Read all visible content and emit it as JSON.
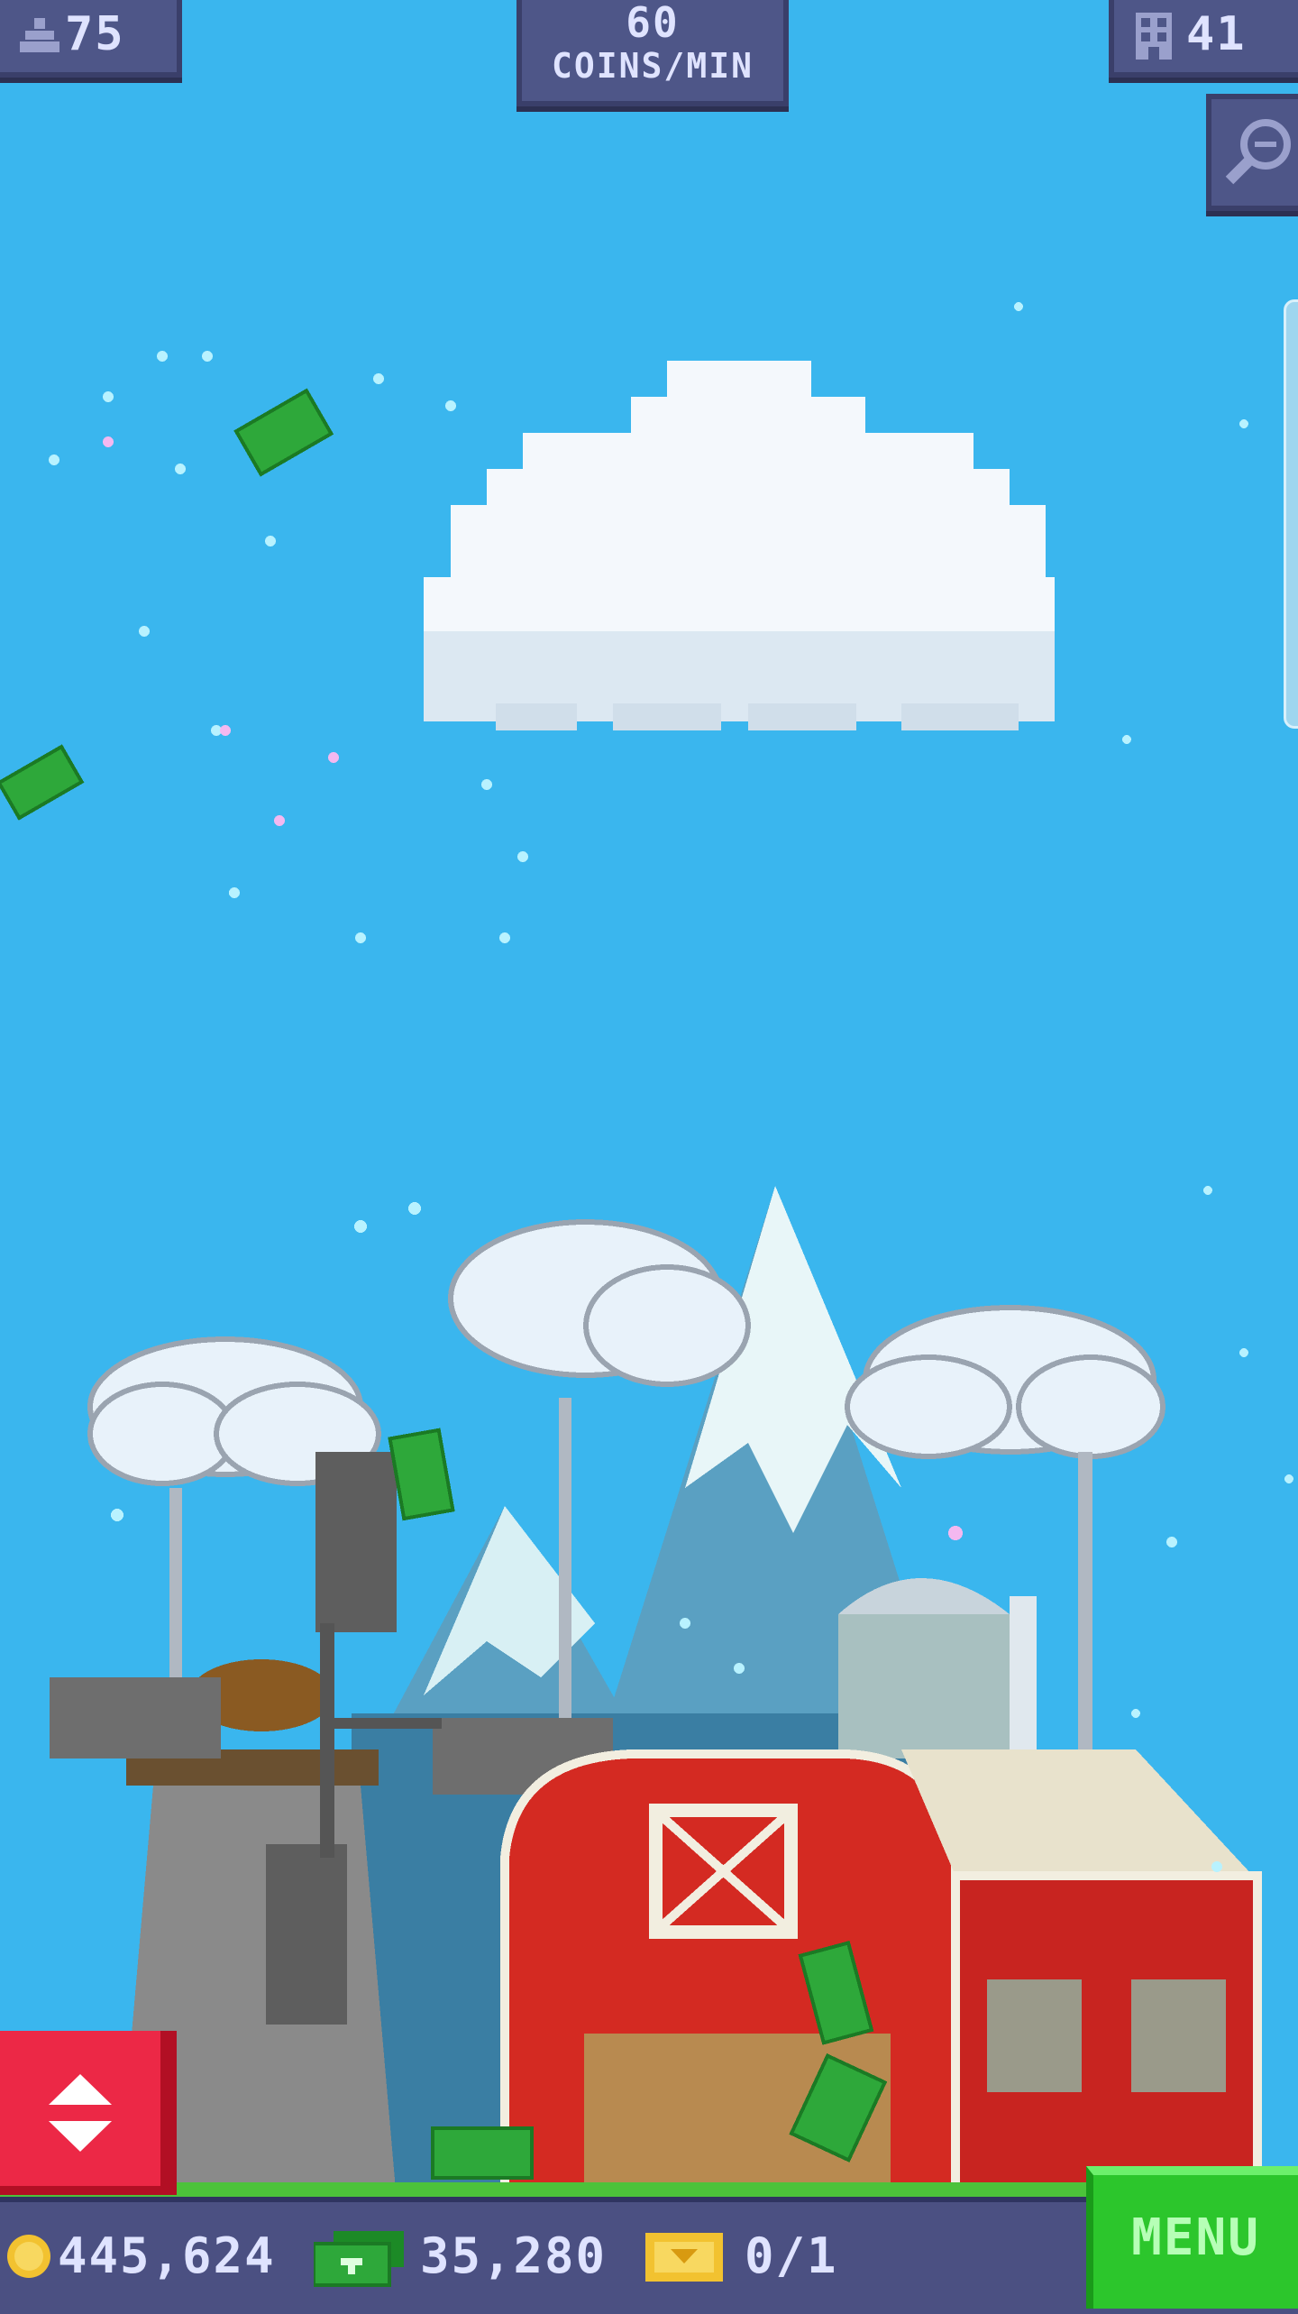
{
  "hud": {
    "population": "75",
    "coins_rate_value": "60",
    "coins_rate_label": "COINS/MIN",
    "floors": "41",
    "population_icon": "person-icon",
    "floors_icon": "building-icon",
    "zoom_icon": "zoom-out-icon"
  },
  "bottom_bar": {
    "coins": "445,624",
    "bux": "35,280",
    "tickets": "0/1",
    "menu_label": "MENU",
    "coin_icon": "coin-icon",
    "bux_icon": "bux-icon",
    "ticket_icon": "ticket-icon"
  },
  "elevator": {
    "icon": "elevator-arrows-icon"
  },
  "colors": {
    "sky": "#3ab6ee",
    "hud_bg": "#4e5688",
    "menu_green": "#2cc62c",
    "elevator_red": "#ec2846",
    "barn_red": "#d42a22"
  }
}
